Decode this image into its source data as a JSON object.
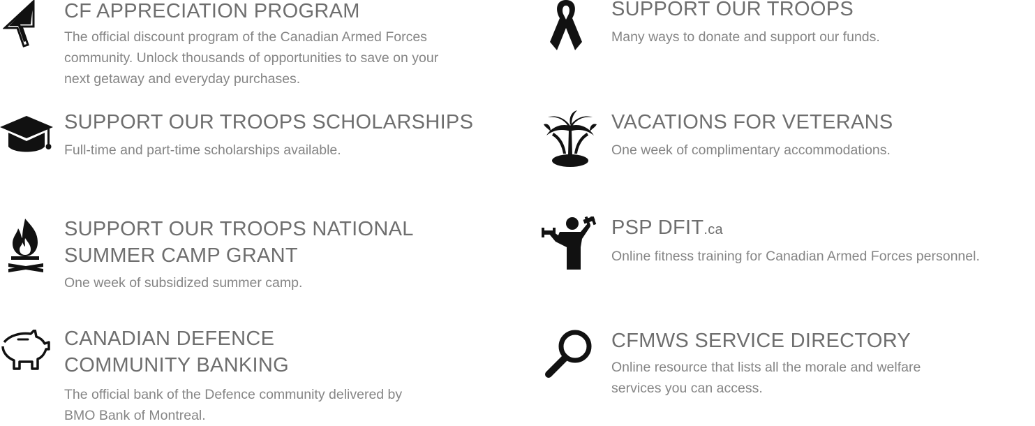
{
  "programs": [
    {
      "icon": "cursor-arrow-icon",
      "title": "CF APPRECIATION PROGRAM",
      "description_lines": [
        "The official discount program of the Canadian Armed Forces",
        "community. Unlock thousands of opportunities to save on your",
        "next getaway and everyday purchases."
      ]
    },
    {
      "icon": "awareness-ribbon-icon",
      "title": "SUPPORT OUR TROOPS",
      "description_lines": [
        "Many ways to donate and support our funds."
      ]
    },
    {
      "icon": "graduation-cap-icon",
      "title": "SUPPORT OUR TROOPS SCHOLARSHIPS",
      "description_lines": [
        "Full-time and part-time scholarships available."
      ]
    },
    {
      "icon": "palm-tree-island-icon",
      "title": "VACATIONS FOR VETERANS",
      "description_lines": [
        "One week of complimentary accommodations."
      ]
    },
    {
      "icon": "campfire-icon",
      "title_lines": [
        "SUPPORT OUR TROOPS NATIONAL",
        "SUMMER CAMP GRANT"
      ],
      "description_lines": [
        "One week of subsidized summer camp."
      ]
    },
    {
      "icon": "fitness-person-icon",
      "title": "PSP DFIT",
      "title_suffix": ".ca",
      "description_lines": [
        "Online fitness training for Canadian Armed Forces personnel."
      ]
    },
    {
      "icon": "piggy-bank-icon",
      "title_lines": [
        "CANADIAN DEFENCE",
        "COMMUNITY BANKING"
      ],
      "description_lines": [
        "The official bank of the Defence community delivered by",
        "BMO Bank of Montreal."
      ]
    },
    {
      "icon": "magnifying-glass-icon",
      "title": "CFMWS SERVICE DIRECTORY",
      "description_lines": [
        "Online resource that lists all the morale and welfare",
        "services you can access."
      ]
    }
  ]
}
